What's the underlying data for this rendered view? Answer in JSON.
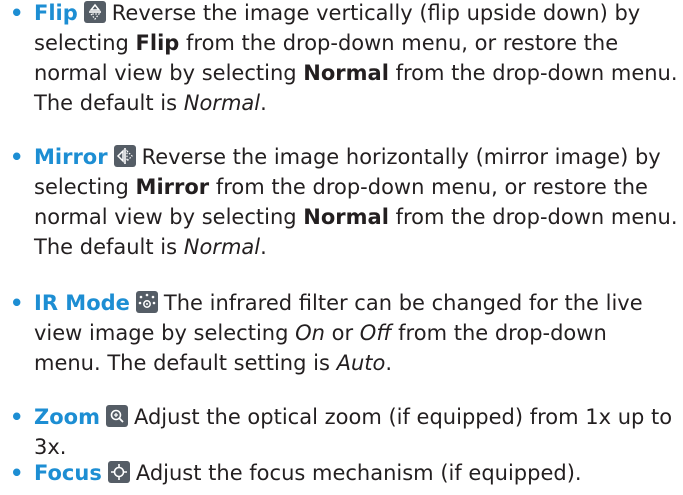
{
  "bullet_glyph": "•",
  "accent_color": "#1d8ed3",
  "icon_color": "#555d66",
  "items": [
    {
      "term": "Flip",
      "icon": "flip-icon",
      "parts": [
        "Reverse the image vertically (flip upside down) by selecting ",
        "Flip",
        " from the drop-down menu, or restore the normal view by selecting ",
        "Normal",
        " from the drop-down menu. The default is ",
        "Normal",
        "."
      ]
    },
    {
      "term": "Mirror",
      "icon": "mirror-icon",
      "parts": [
        "Reverse the image horizontally (mirror image) by selecting ",
        "Mirror",
        " from the drop-down menu, or restore the normal view by selecting ",
        "Normal",
        " from the drop-down menu. The default is ",
        "Normal",
        "."
      ]
    },
    {
      "term": "IR Mode",
      "icon": "ir-mode-icon",
      "parts": [
        "The infrared filter can be changed for the live view image by selecting ",
        "On",
        " or ",
        "Off",
        " from the drop-down menu. The default setting is ",
        "Auto",
        "."
      ]
    },
    {
      "term": "Zoom",
      "icon": "zoom-icon",
      "parts": [
        "Adjust the optical zoom (if equipped) from 1x up to 3x."
      ]
    },
    {
      "term": "Focus",
      "icon": "focus-icon",
      "parts": [
        "Adjust the focus mechanism (if equipped)."
      ]
    }
  ]
}
